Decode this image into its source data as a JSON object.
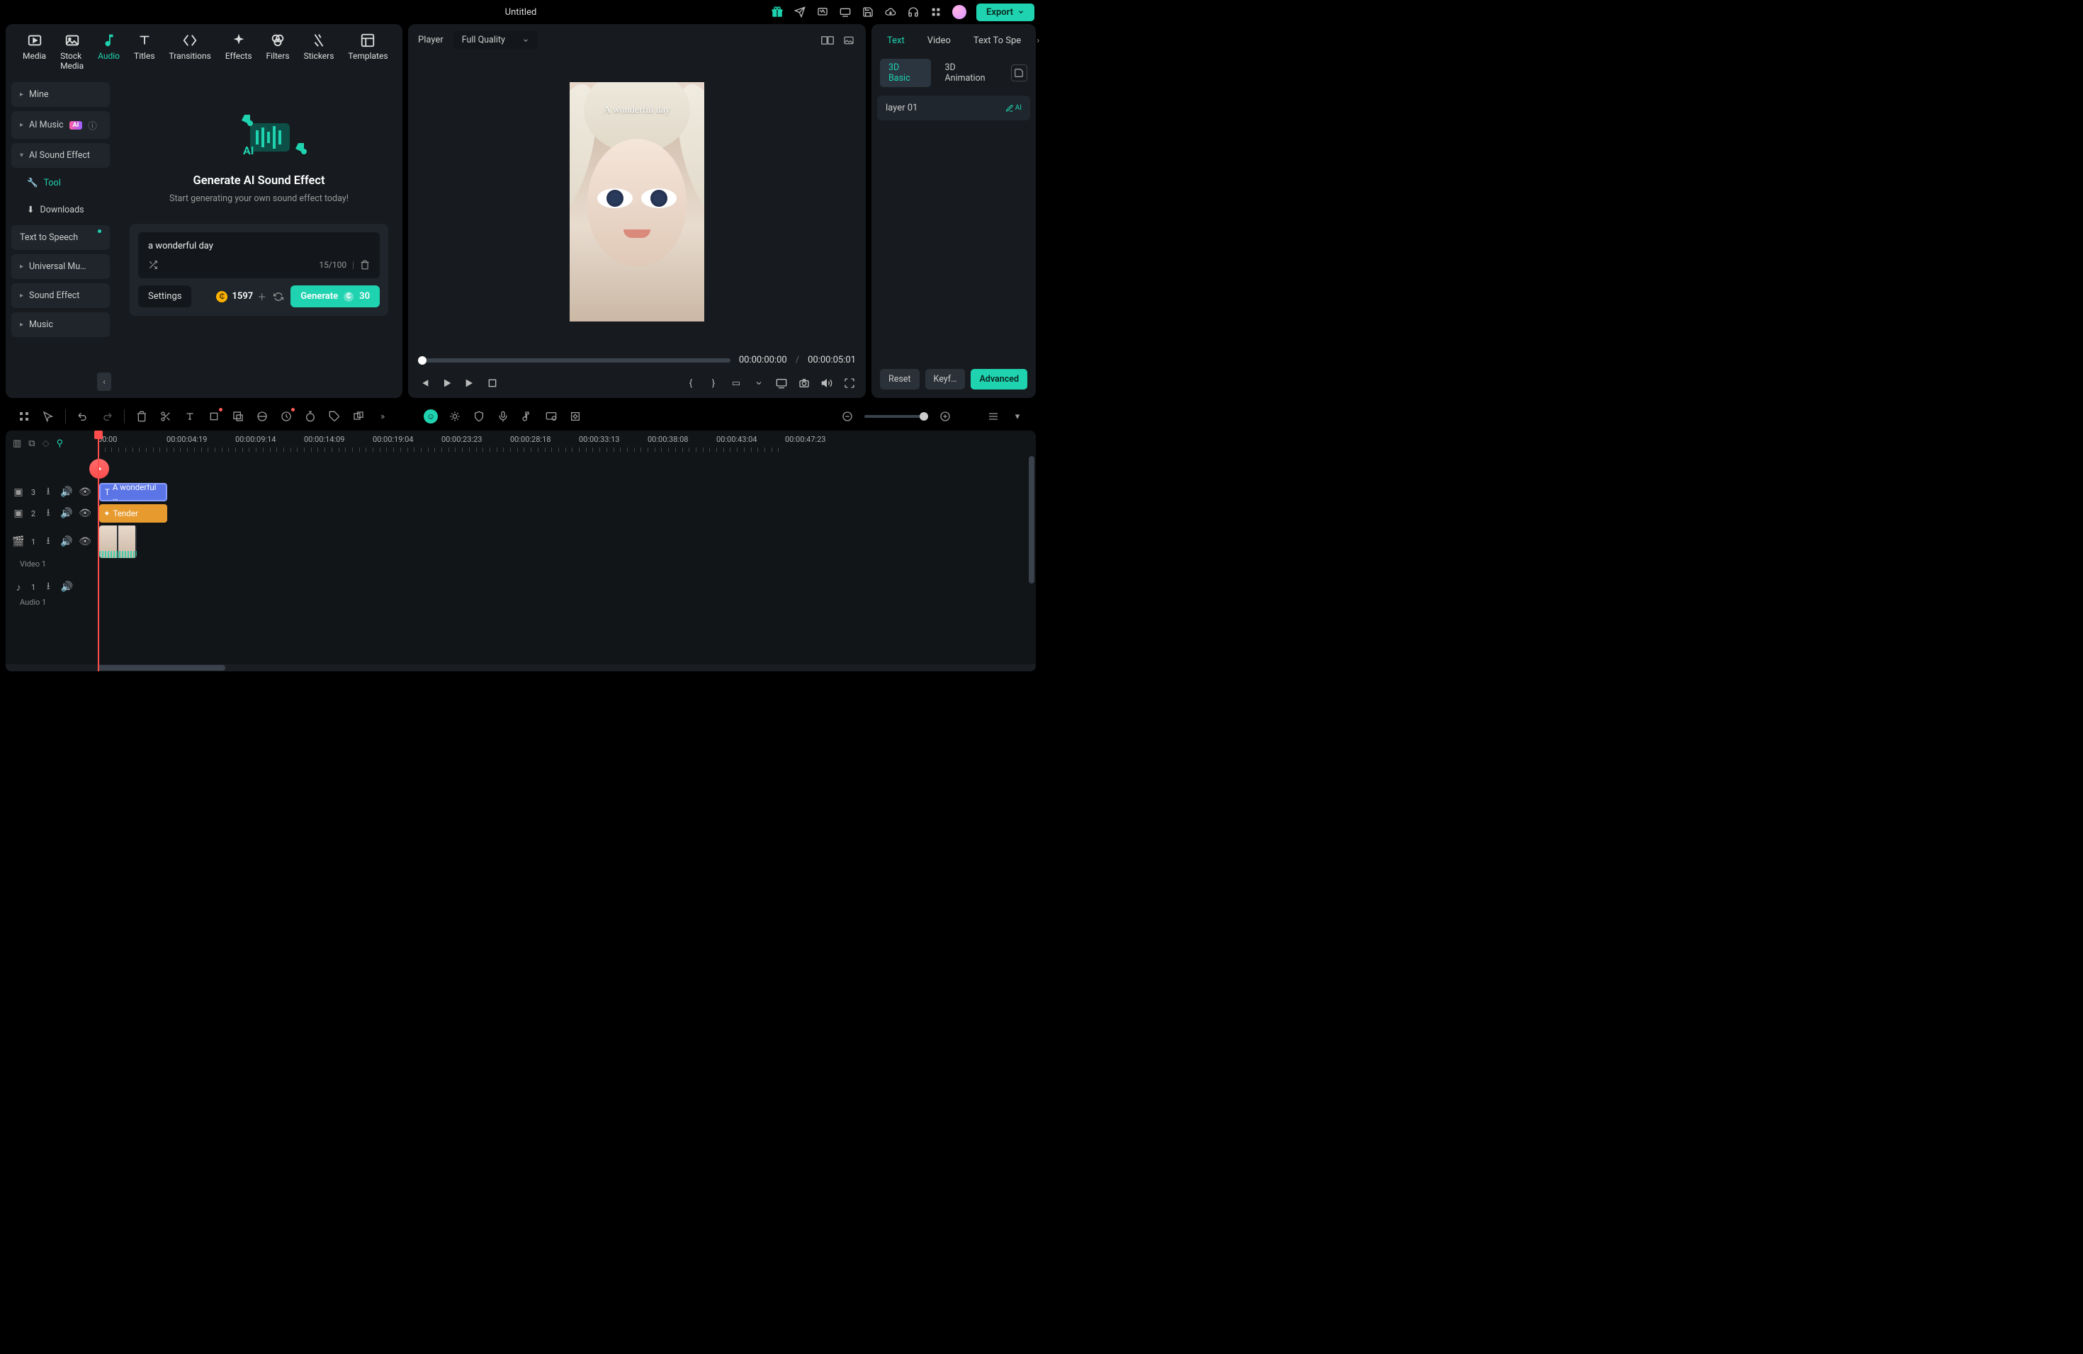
{
  "titlebar": {
    "title": "Untitled",
    "export": "Export"
  },
  "topTabs": [
    "Media",
    "Stock Media",
    "Audio",
    "Titles",
    "Transitions",
    "Effects",
    "Filters",
    "Stickers",
    "Templates"
  ],
  "sidebar": {
    "mine": "Mine",
    "aiMusic": "AI Music",
    "aiSoundEffect": "AI Sound Effect",
    "tool": "Tool",
    "downloads": "Downloads",
    "textToSpeech": "Text to Speech",
    "universalMusic": "Universal Mu…",
    "soundEffect": "Sound Effect",
    "music": "Music",
    "aiBadge": "AI"
  },
  "center": {
    "title": "Generate AI Sound Effect",
    "sub": "Start generating your own sound effect today!",
    "prompt": "a wonderful day",
    "counter": "15/100",
    "settings": "Settings",
    "credits": "1597",
    "generate": "Generate",
    "genCost": "30"
  },
  "preview": {
    "label": "Player",
    "quality": "Full Quality",
    "overlay": "A wonderful day",
    "cur": "00:00:00:00",
    "dur": "00:00:05:01"
  },
  "inspector": {
    "tabs": [
      "Text",
      "Video",
      "Text To Spe"
    ],
    "subs": [
      "3D Basic",
      "3D Animation"
    ],
    "layer": "layer 01",
    "aiEdit": "AI",
    "reset": "Reset",
    "keyframe": "Keyframe P…",
    "advanced": "Advanced"
  },
  "ruler": [
    "00:00",
    "00:00:04:19",
    "00:00:09:14",
    "00:00:14:09",
    "00:00:19:04",
    "00:00:23:23",
    "00:00:28:18",
    "00:00:33:13",
    "00:00:38:08",
    "00:00:43:04",
    "00:00:47:23"
  ],
  "clips": {
    "text": "A wonderful …",
    "effect": "Tender"
  },
  "tracks": {
    "t3": "3",
    "t2": "2",
    "t1": "1",
    "a1": "1",
    "video1": "Video 1",
    "audio1": "Audio 1"
  }
}
